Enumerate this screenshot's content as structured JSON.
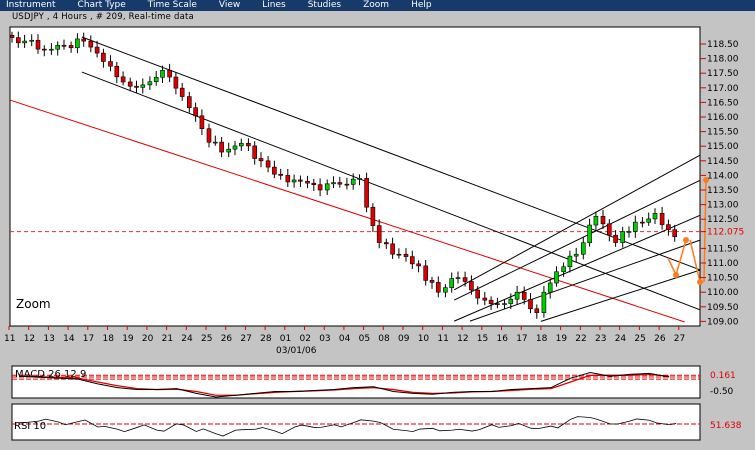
{
  "menu": [
    "Instrument",
    "Chart Type",
    "Time Scale",
    "View",
    "Lines",
    "Studies",
    "Zoom",
    "Help"
  ],
  "title": "USDJPY , 4 Hours , # 209, Real-time data",
  "zoom_label": "Zoom",
  "colors": {
    "menu_bg": "#163a6a",
    "up": "#00cc00",
    "down": "#dd0000",
    "accent": "#e00000",
    "arrows": "#ff7a1a"
  },
  "chart_data": [
    {
      "type": "candlestick",
      "price_ticks": [
        "118.50",
        "118.00",
        "117.50",
        "117.00",
        "116.50",
        "116.00",
        "115.50",
        "115.00",
        "114.50",
        "114.00",
        "113.50",
        "113.00",
        "112.50",
        "112.075",
        "111.50",
        "111.00",
        "110.50",
        "110.00",
        "109.50",
        "109.00"
      ],
      "current_price": 112.075,
      "ylim": [
        109.0,
        118.5
      ],
      "date_ticks": [
        "11",
        "12",
        "13",
        "14",
        "17",
        "18",
        "19",
        "20",
        "21",
        "24",
        "25",
        "26",
        "27",
        "28",
        "01",
        "02",
        "03",
        "04",
        "05",
        "08",
        "09",
        "10",
        "11",
        "12",
        "15",
        "16",
        "17",
        "18",
        "19",
        "22",
        "23",
        "24",
        "25",
        "26",
        "27"
      ],
      "date_sublabel": "03/01/06",
      "closes": [
        118.6,
        118.3,
        118.45,
        118.6,
        117.9,
        117.2,
        117.1,
        117.6,
        116.7,
        115.6,
        114.8,
        115.1,
        114.5,
        114.0,
        113.8,
        113.5,
        113.7,
        113.9,
        111.7,
        111.3,
        110.9,
        110.0,
        110.5,
        109.8,
        109.6,
        110.0,
        109.3,
        110.7,
        111.3,
        112.6,
        111.7,
        112.4,
        112.7,
        111.9
      ],
      "open_first": 118.8,
      "trendlines": [
        {
          "color": "#000000",
          "from": [
            3.7,
            118.74
          ],
          "to": [
            35.1,
            110.76
          ]
        },
        {
          "color": "#000000",
          "from": [
            3.7,
            117.54
          ],
          "to": [
            35.1,
            109.39
          ]
        },
        {
          "color": "#e00000",
          "from": [
            0.05,
            116.58
          ],
          "to": [
            34.3,
            108.98
          ]
        },
        {
          "color": "#000000",
          "from": [
            22.6,
            109.01
          ],
          "to": [
            35.1,
            112.64
          ]
        },
        {
          "color": "#000000",
          "from": [
            23.4,
            109.01
          ],
          "to": [
            35.1,
            111.79
          ]
        },
        {
          "color": "#000000",
          "from": [
            27.0,
            109.0
          ],
          "to": [
            35.1,
            110.76
          ]
        },
        {
          "color": "#000000",
          "from": [
            22.6,
            110.08
          ],
          "to": [
            35.1,
            114.7
          ]
        },
        {
          "color": "#000000",
          "from": [
            22.6,
            109.73
          ],
          "to": [
            35.1,
            113.84
          ]
        }
      ]
    },
    {
      "type": "line",
      "title": "MACD 26 12 9",
      "value_label": "0.161",
      "tick_label": "-0.50",
      "macd": [
        0.2,
        0.15,
        0.1,
        0.05,
        -0.2,
        -0.4,
        -0.5,
        -0.5,
        -0.45,
        -0.7,
        -0.9,
        -0.8,
        -0.7,
        -0.6,
        -0.6,
        -0.55,
        -0.5,
        -0.4,
        -0.35,
        -0.6,
        -0.7,
        -0.75,
        -0.65,
        -0.6,
        -0.6,
        -0.5,
        -0.45,
        -0.4,
        0.1,
        0.4,
        0.2,
        0.3,
        0.35,
        0.16
      ],
      "signal": [
        0.2,
        0.18,
        0.14,
        0.1,
        -0.1,
        -0.3,
        -0.45,
        -0.5,
        -0.48,
        -0.6,
        -0.8,
        -0.8,
        -0.72,
        -0.65,
        -0.6,
        -0.57,
        -0.52,
        -0.45,
        -0.4,
        -0.5,
        -0.65,
        -0.7,
        -0.68,
        -0.62,
        -0.6,
        -0.55,
        -0.48,
        -0.45,
        -0.1,
        0.25,
        0.25,
        0.25,
        0.3,
        0.2
      ]
    },
    {
      "type": "line",
      "title": "RSI 10",
      "value_label": "51.638",
      "rsi": [
        55,
        58,
        56,
        57,
        45,
        40,
        44,
        38,
        52,
        35,
        30,
        38,
        40,
        36,
        45,
        44,
        50,
        55,
        58,
        40,
        35,
        42,
        38,
        36,
        50,
        48,
        42,
        47,
        62,
        66,
        52,
        58,
        60,
        50
      ]
    }
  ]
}
